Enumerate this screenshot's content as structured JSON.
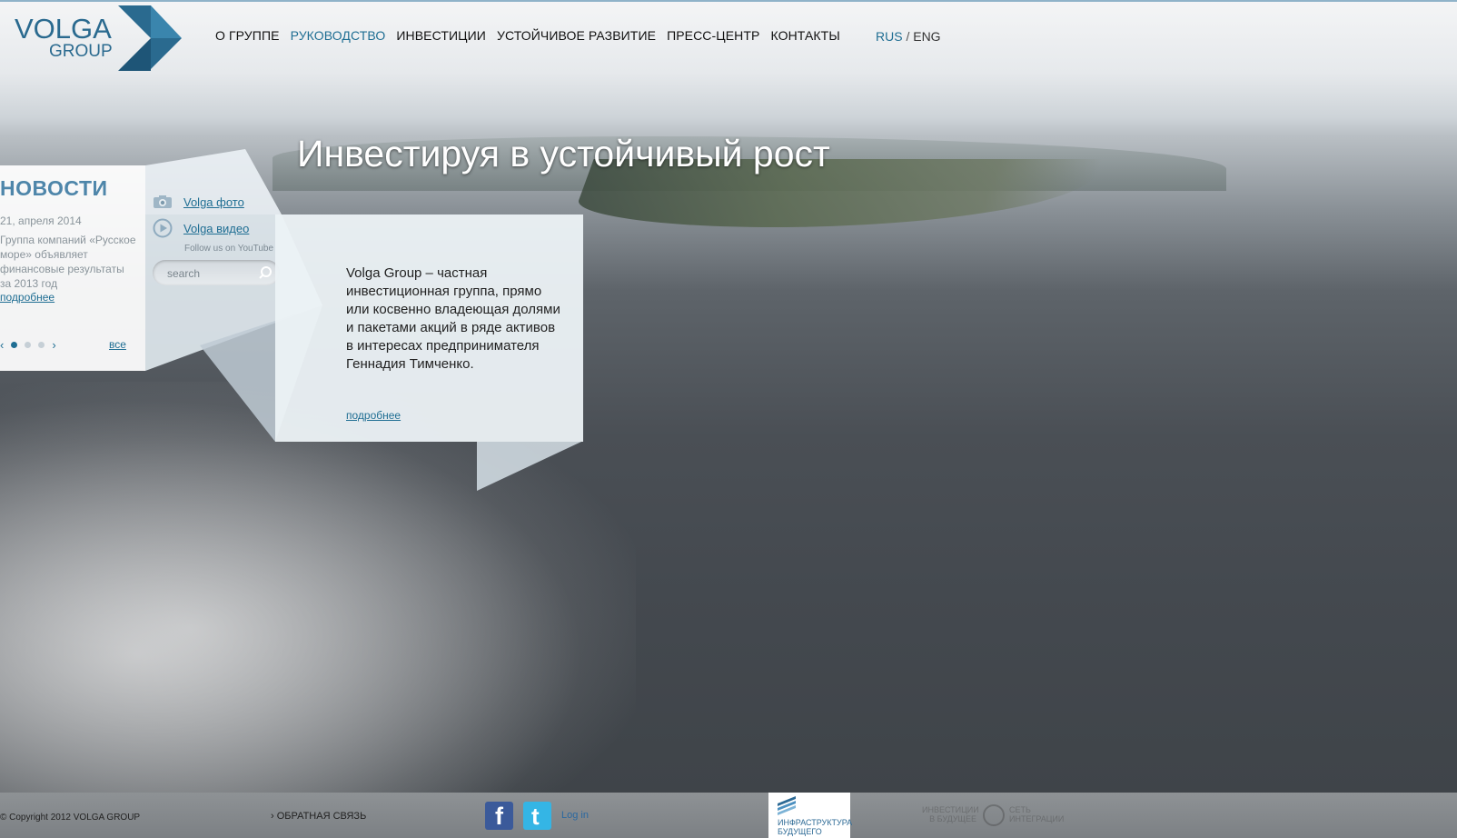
{
  "brand": {
    "name_top": "VOLGA",
    "name_bottom": "GROUP",
    "color": "#2a6a8f"
  },
  "nav": {
    "items": [
      {
        "label": "О ГРУППЕ",
        "active": false
      },
      {
        "label": "РУКОВОДСТВО",
        "active": true
      },
      {
        "label": "ИНВЕСТИЦИИ",
        "active": false
      },
      {
        "label": "УСТОЙЧИВОЕ РАЗВИТИЕ",
        "active": false
      },
      {
        "label": "ПРЕСС-ЦЕНТР",
        "active": false
      },
      {
        "label": "КОНТАКТЫ",
        "active": false
      }
    ],
    "lang_rus": "RUS",
    "lang_sep": "/",
    "lang_eng": "ENG"
  },
  "hero": {
    "headline": "Инвестируя в устойчивый рост"
  },
  "news": {
    "title": "НОВОСТИ",
    "date": "21, апреля 2014",
    "text": "Группа компаний «Русское море» объявляет финансовые результаты за 2013 год",
    "more": "подробнее",
    "prev": "‹",
    "next": "›",
    "all": "все",
    "pages": 3,
    "current_page": 1
  },
  "media": {
    "photo_label": "Volga фото",
    "video_label": "Volga видео",
    "follow": "Follow us on YouTube",
    "search_placeholder": "search"
  },
  "about": {
    "text": "Volga Group – частная инвестиционная группа, прямо или косвенно владеющая долями и пакетами акций в ряде активов в интересах предпринимателя Геннадия Тимченко.",
    "more": "подробнее"
  },
  "footer": {
    "copyright": "© Copyright 2012 VOLGA GROUP",
    "feedback": "› ОБРАТНАЯ СВЯЗЬ",
    "facebook": "f",
    "twitter": "t",
    "login": "Log in",
    "infra_line1": "ИНФРАСТРУКТУРА",
    "infra_line2": "БУДУЩЕГО",
    "partner_left": "ИНВЕСТИЦИИ В БУДУЩЕЕ",
    "partner_right": "СЕТЬ ИНТЕГРАЦИИ"
  },
  "colors": {
    "accent": "#1f6e93",
    "facebook": "#3b5a9a",
    "twitter": "#34b5e5"
  }
}
